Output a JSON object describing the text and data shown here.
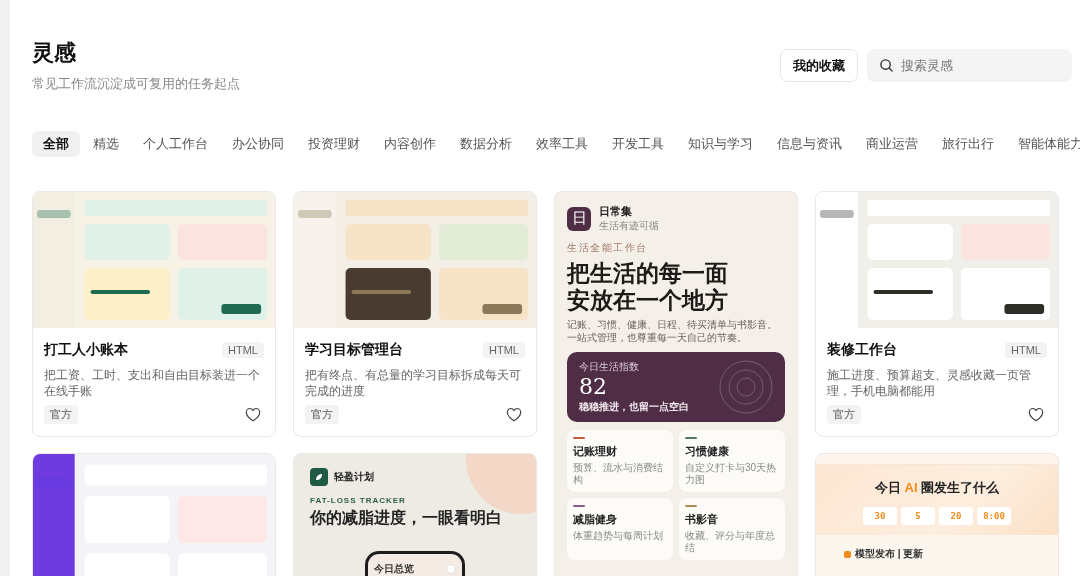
{
  "page": {
    "title": "灵感",
    "subtitle": "常见工作流沉淀成可复用的任务起点"
  },
  "favorites_button": {
    "label": "我的收藏"
  },
  "search": {
    "placeholder": "搜索灵感"
  },
  "tabs": [
    {
      "label": "全部",
      "selected": true
    },
    {
      "label": "精选",
      "selected": false
    },
    {
      "label": "个人工作台",
      "selected": false
    },
    {
      "label": "办公协同",
      "selected": false
    },
    {
      "label": "投资理财",
      "selected": false
    },
    {
      "label": "内容创作",
      "selected": false
    },
    {
      "label": "数据分析",
      "selected": false
    },
    {
      "label": "效率工具",
      "selected": false
    },
    {
      "label": "开发工具",
      "selected": false
    },
    {
      "label": "知识与学习",
      "selected": false
    },
    {
      "label": "信息与资讯",
      "selected": false
    },
    {
      "label": "商业运营",
      "selected": false
    },
    {
      "label": "旅行出行",
      "selected": false
    },
    {
      "label": "智能体能力",
      "selected": false
    }
  ],
  "columns": [
    [
      {
        "kind": "template",
        "title": "打工人小账本",
        "format": "HTML",
        "description": "把工资、工时、支出和自由目标装进一个在线手账",
        "tag": "官方",
        "favorited": false
      },
      {
        "kind": "preview_only"
      }
    ],
    [
      {
        "kind": "template",
        "title": "学习目标管理台",
        "format": "HTML",
        "description": "把有终点、有总量的学习目标拆成每天可完成的进度",
        "tag": "官方",
        "favorited": false
      },
      {
        "kind": "fat_loss",
        "brand": "轻盈计划",
        "eyebrow": "FAT-LOSS TRACKER",
        "headline": "你的减脂进度，一眼看明白",
        "phone_title": "今日总览"
      }
    ],
    [
      {
        "kind": "life",
        "logo_char": "日",
        "brand": "日常集",
        "tagline": "生活有迹可循",
        "eyebrow": "生活全能工作台",
        "headline_lines": [
          "把生活的每一面",
          "安放在一个地方"
        ],
        "description": "记账、习惯、健康、日程、待买清单与书影音。一站式管理，也尊重每一天自己的节奏。",
        "index": {
          "label": "今日生活指数",
          "value": "82",
          "note": "稳稳推进，也留一点空白"
        },
        "tiles": [
          {
            "title": "记账理财",
            "subtitle": "预算、流水与消费结构",
            "color": "#c0603f"
          },
          {
            "title": "习惯健康",
            "subtitle": "自定义打卡与30天热力图",
            "color": "#4f7a63"
          },
          {
            "title": "减脂健身",
            "subtitle": "体重趋势与每周计划",
            "color": "#8a5f86"
          },
          {
            "title": "书影音",
            "subtitle": "收藏、评分与年度总结",
            "color": "#b08d4f"
          }
        ]
      }
    ],
    [
      {
        "kind": "template",
        "title": "装修工作台",
        "format": "HTML",
        "description": "施工进度、预算超支、灵感收藏一页管理，手机电脑都能用",
        "tag": "官方",
        "favorited": false
      },
      {
        "kind": "ai_news",
        "title_parts": [
          {
            "text": "今日 ",
            "highlight": false
          },
          {
            "text": "AI",
            "highlight": true
          },
          {
            "text": " 圈发生了什么",
            "highlight": false
          }
        ],
        "stats": [
          "30",
          "5",
          "20",
          "8:00"
        ],
        "section_title": "模型发布 | 更新"
      }
    ]
  ]
}
